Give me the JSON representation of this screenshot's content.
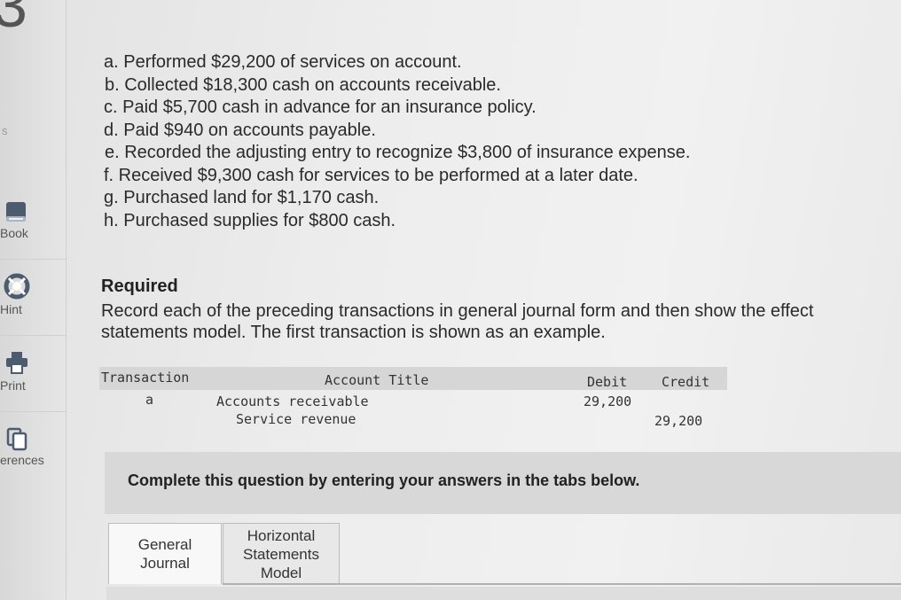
{
  "question_number": "3",
  "sidebar": {
    "partial_label": "s",
    "items": [
      {
        "label": "Book",
        "icon": "book-icon"
      },
      {
        "label": "Hint",
        "icon": "lifebuoy-icon"
      },
      {
        "label": "Print",
        "icon": "printer-icon"
      },
      {
        "label": "erences",
        "icon": "copy-icon"
      }
    ]
  },
  "transactions": [
    "a. Performed $29,200 of services on account.",
    "b. Collected $18,300 cash on accounts receivable.",
    "c. Paid $5,700 cash in advance for an insurance policy.",
    "d. Paid $940 on accounts payable.",
    "e. Recorded the adjusting entry to recognize $3,800 of insurance expense.",
    "f. Received $9,300 cash for services to be performed at a later date.",
    "g. Purchased land for $1,170 cash.",
    "h. Purchased supplies for $800 cash."
  ],
  "required": {
    "heading": "Required",
    "line1": "Record each of the preceding transactions in general journal form and then show the effect",
    "line2": "statements model. The first transaction is shown as an example."
  },
  "example_table": {
    "headers": {
      "transaction": "Transaction",
      "account": "Account Title",
      "debit": "Debit",
      "credit": "Credit"
    },
    "rows": [
      {
        "transaction": "a",
        "account": "Accounts receivable",
        "debit": "29,200",
        "credit": ""
      },
      {
        "transaction": "",
        "account": "Service revenue",
        "debit": "",
        "credit": "29,200"
      }
    ]
  },
  "complete_text": "Complete this question by entering your answers in the tabs below.",
  "tabs": [
    {
      "label": "General\nJournal",
      "active": true
    },
    {
      "label": "Horizontal\nStatements\nModel",
      "active": false
    }
  ]
}
